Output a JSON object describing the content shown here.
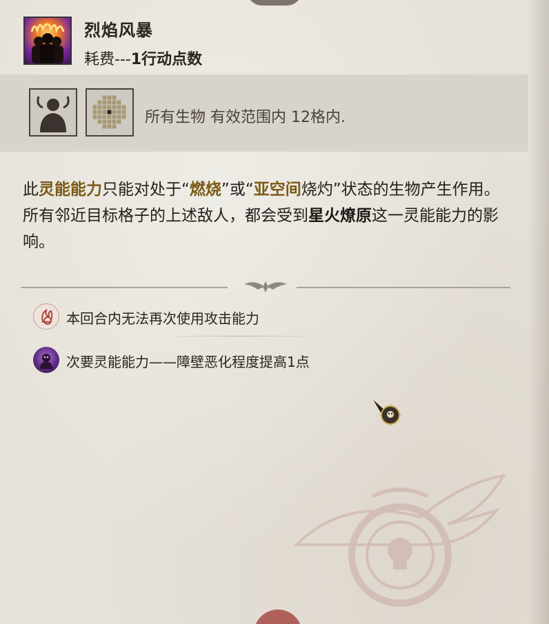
{
  "ability": {
    "name": "烈焰风暴",
    "cost_prefix": "耗费---",
    "cost_value": "1",
    "cost_suffix": "行动点数",
    "icon": "flame-storm-icon"
  },
  "targeting": {
    "creature_icon": "creature-target-icon",
    "area_icon": "area-grid-icon",
    "text": "所有生物 有效范围内 12格内."
  },
  "description": {
    "p1": "此",
    "k1": "灵能能力",
    "p2": "只能对处于“",
    "k2": "燃烧",
    "p3": "”或“",
    "k3": "亚空间",
    "p4": "烧灼”状态的生物产生作用。所有邻近目标格子的上述敌人，都会受到",
    "k4": "星火燎原",
    "p5": "这一灵能能力的影响。"
  },
  "effects": [
    {
      "icon": "attack-lock-icon",
      "text": "本回合内无法再次使用攻击能力"
    },
    {
      "icon": "psychic-minor-icon",
      "text": "次要灵能能力——障壁恶化程度提高1点"
    }
  ],
  "colors": {
    "parchment": "#e6e2d9",
    "keyword": "#7a5a16",
    "text": "#241e1a"
  }
}
